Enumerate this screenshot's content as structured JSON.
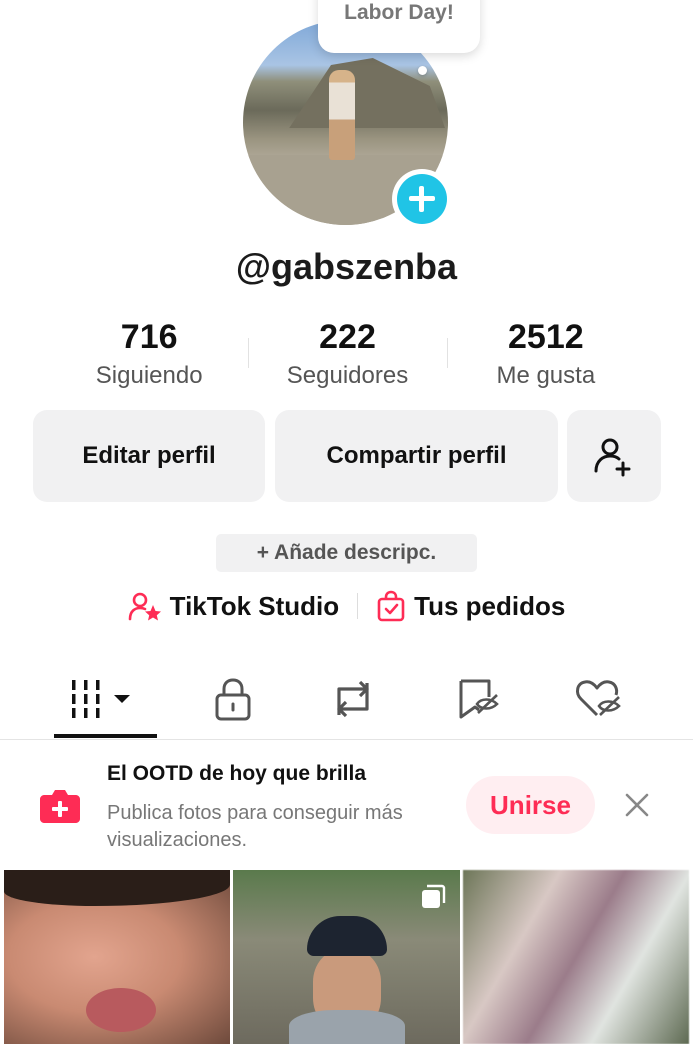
{
  "profile": {
    "avatar_alt": "avatar",
    "bubble_text": "Labor Day!",
    "username": "@gabszenba"
  },
  "stats": [
    {
      "value": "716",
      "label": "Siguiendo"
    },
    {
      "value": "222",
      "label": "Seguidores"
    },
    {
      "value": "2512",
      "label": "Me gusta"
    }
  ],
  "buttons": {
    "edit": "Editar perfil",
    "share": "Compartir perfil"
  },
  "bio": {
    "add_label": "+ Añade descripc."
  },
  "links": {
    "studio": "TikTok Studio",
    "orders": "Tus pedidos"
  },
  "promo": {
    "title": "El OOTD de hoy que brilla",
    "subtitle": "Publica fotos para conseguir más visualizaciones.",
    "join": "Unirse"
  },
  "colors": {
    "accent": "#fe2c55",
    "badge": "#20c4e6",
    "button_bg": "#f1f1f2"
  }
}
